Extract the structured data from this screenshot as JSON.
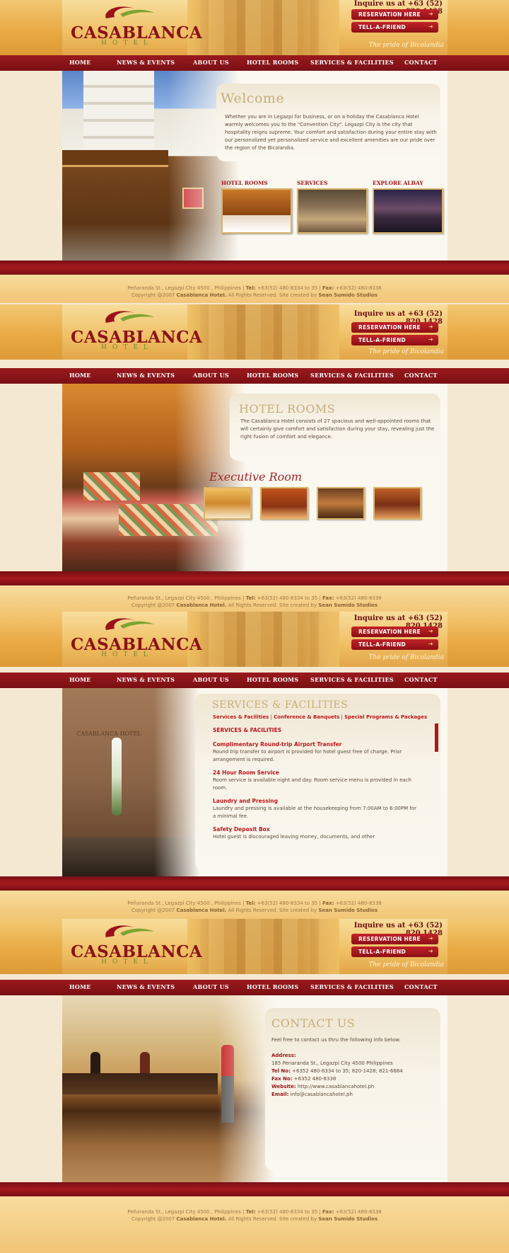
{
  "header": {
    "logo_text": "CASABLANCA",
    "logo_sub": "HOTEL",
    "inquire": "Inquire us at +63 (52) 820.1428",
    "reservation_label": "RESERVATION HERE",
    "tell_friend_label": "TELL-A-FRIEND",
    "tagline": "The pride of Bicolandia"
  },
  "nav": {
    "items": [
      "HOME",
      "NEWS & EVENTS",
      "ABOUT US",
      "HOTEL ROOMS",
      "SERVICES & FACILITIES",
      "CONTACT"
    ]
  },
  "footer": {
    "address": "Peñaranda St., Legazpi City 4500 , Philippines",
    "tel_label": "Tel:",
    "tel": "+63(52) 480-8334 to 35",
    "fax_label": "Fax:",
    "fax": "+63(52) 480-8338",
    "copyright_prefix": "Copyright @2007",
    "copyright_owner": "Casablanca Hotel.",
    "copyright_rest": "All Rights Reserved. Site created by",
    "creator": "Sean Sumido Studios"
  },
  "welcome": {
    "title": "Welcome",
    "body": "Whether you are in Legazpi for business, or on a holiday the Casablanca Hotel warmly welcomes you to the \"Convention City\". Legazpi City is the city that hospitality reigns supreme. Your comfort and satisfaction during your entire stay with our personalized yet personalized service and excellent amenities are our pride over the region of the Bicolandia.",
    "thumbs": [
      "HOTEL ROOMS",
      "SERVICES",
      "EXPLORE ALBAY"
    ]
  },
  "rooms": {
    "title": "HOTEL ROOMS",
    "body": "The Casablanca Hotel consists of 27 spacious and well-appointed rooms that will certainly give comfort and satisfaction during your stay, revealing just the right fusion of comfort and elegance.",
    "script_label": "Executive Room"
  },
  "services": {
    "title": "SERVICES & FACILITIES",
    "links": [
      "Services & Facilities",
      "Conference & Banquets",
      "Special Programs & Packages"
    ],
    "heading": "SERVICES & FACILITIES",
    "items": [
      {
        "title": "Complimentary Round-trip Airport Transfer",
        "text": "Round trip transfer to airport is provided for hotel guest free of charge. Prior arrangement is required."
      },
      {
        "title": "24 Hour Room Service",
        "text": "Room service is available night and day. Room service menu is provided in each room."
      },
      {
        "title": "Laundry and Pressing",
        "text": "Laundry and pressing is available at the housekeeping from 7:00AM to 6:00PM for a minimal fee."
      },
      {
        "title": "Safety Deposit Box",
        "text": "Hotel guest is discouraged leaving money, documents, and other"
      }
    ]
  },
  "contact": {
    "title": "CONTACT US",
    "intro": "Feel free to contact us thru the following info below:",
    "address_label": "Address:",
    "address": "185 Penaranda St., Legazpi City 4500 Philippines",
    "tel_label": "Tel No:",
    "tel": "+6352 480-8334 to 35; 820-1428; 821-6684",
    "fax_label": "Fax No:",
    "fax": "+6352 480-8338",
    "website_label": "Website:",
    "website": "http://www.casablancahotel.ph",
    "email_label": "Email:",
    "email": "info@casablancahotel.ph"
  },
  "colors": {
    "brand_red": "#8a1218",
    "gold": "#efbf63",
    "accent_red": "#c0141b"
  }
}
